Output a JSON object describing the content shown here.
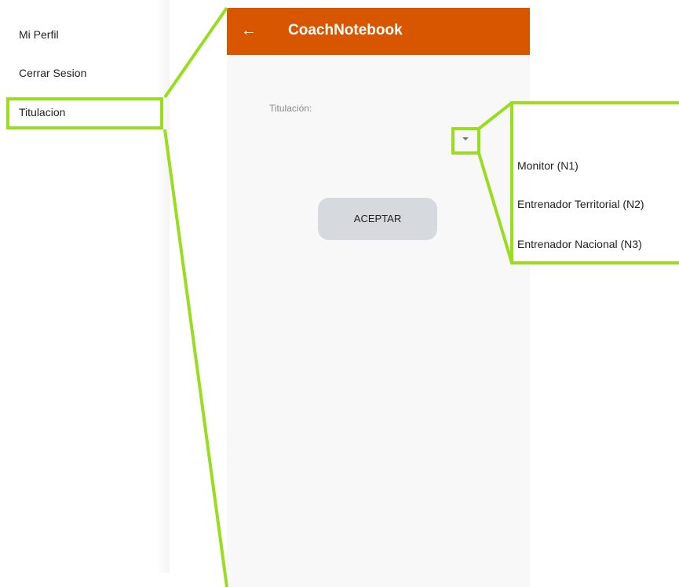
{
  "menu": {
    "items": [
      {
        "label": "Mi Perfil"
      },
      {
        "label": "Cerrar Sesion"
      },
      {
        "label": "Titulacion"
      }
    ]
  },
  "appbar": {
    "title": "CoachNotebook",
    "back_icon": "←"
  },
  "form": {
    "field_label": "Titulación:",
    "accept_label": "ACEPTAR"
  },
  "dropdown": {
    "options": [
      {
        "label": "Monitor (N1)"
      },
      {
        "label": "Entrenador Territorial (N2)"
      },
      {
        "label": "Entrenador Nacional (N3)"
      }
    ]
  },
  "colors": {
    "appbar": "#d85600",
    "highlight": "#99dd1e",
    "button": "#d6d9dd",
    "screen_bg": "#f8f8f8"
  }
}
